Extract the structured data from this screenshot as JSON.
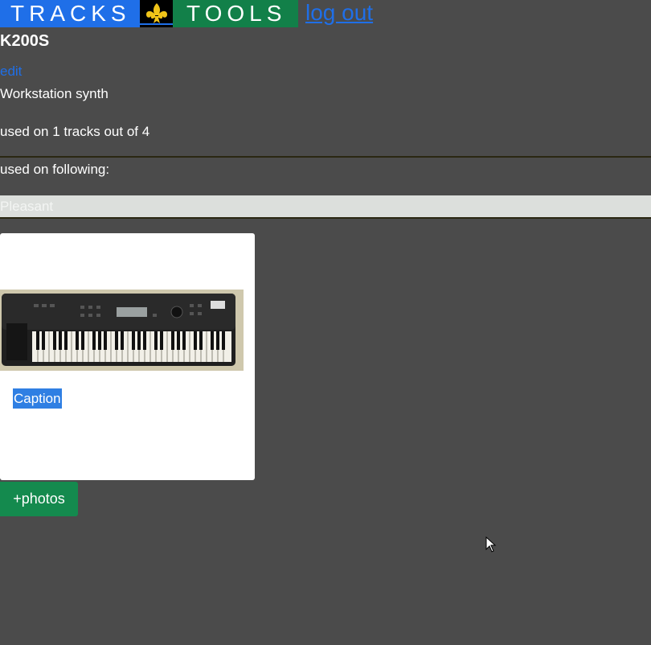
{
  "header": {
    "tracks_label": "TRACKS",
    "tools_label": "TOOLS",
    "logout_label": "log out",
    "colors": {
      "tracks_bg": "#1f6fe8",
      "tools_bg": "#128049",
      "logo_bg": "#000000",
      "logo": "#f0c419",
      "link": "#1f6fe8"
    }
  },
  "instrument": {
    "name": "K200S",
    "edit_label": "edit",
    "description": "Workstation synth",
    "usage_text": "used on 1 tracks out of 4"
  },
  "used_on": {
    "heading": "used on following:",
    "tracks": [
      "Pleasant"
    ]
  },
  "photo_card": {
    "image_icon": "keyboard-synth-photo",
    "caption": "Caption"
  },
  "actions": {
    "add_photos_label": "+photos"
  }
}
